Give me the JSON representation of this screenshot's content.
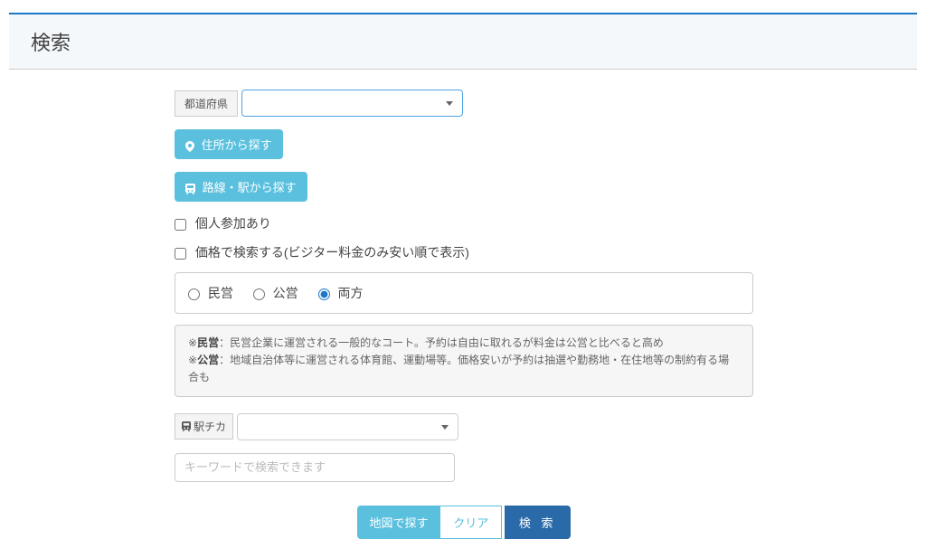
{
  "title": "検索",
  "form": {
    "prefecture_label": "都道府県",
    "prefecture_value": "",
    "address_search_label": "住所から探す",
    "line_station_search_label": "路線・駅から探す",
    "individual_participation_label": "個人参加あり",
    "price_search_label": "価格で検索する(ビジター料金のみ安い順で表示)",
    "operation_type": {
      "private_label": "民営",
      "public_label": "公営",
      "both_label": "両方",
      "selected": "both",
      "desc_prefix": "※",
      "private_desc_label": "民営",
      "private_desc_text": "：民営企業に運営される一般的なコート。予約は自由に取れるが料金は公営と比べると高め",
      "public_desc_label": "公営",
      "public_desc_text": "：地域自治体等に運営される体育館、運動場等。価格安いが予約は抽選や勤務地・在住地等の制約有る場合も"
    },
    "station_near_label": "駅チカ",
    "station_near_value": "",
    "keyword_placeholder": "キーワードで検索できます",
    "keyword_value": "",
    "buttons": {
      "map_search": "地図で探す",
      "clear": "クリア",
      "search": "検 索"
    }
  }
}
